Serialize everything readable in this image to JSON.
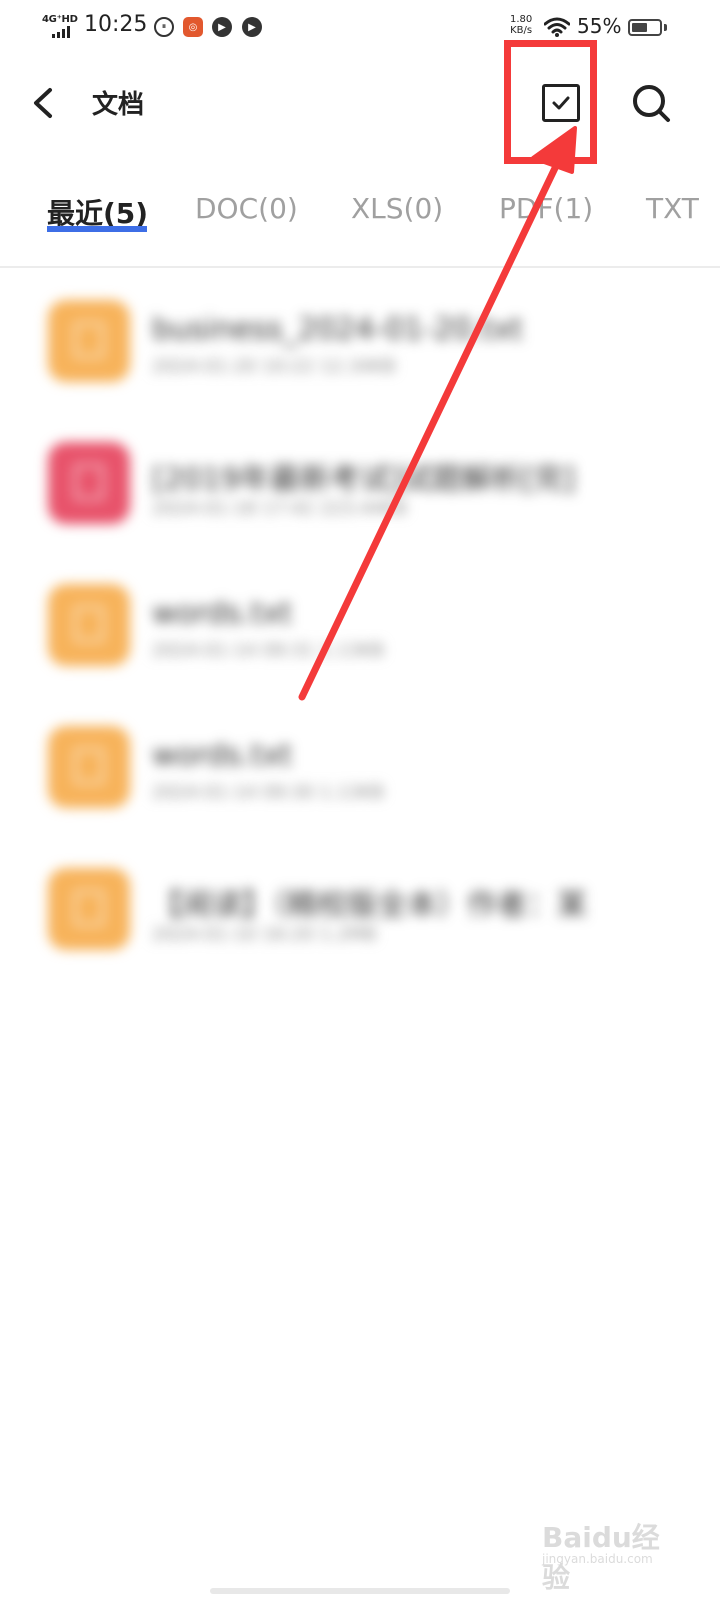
{
  "status_bar": {
    "network": "4G⁺HD",
    "time": "10:25",
    "net_speed_value": "1.80",
    "net_speed_unit": "KB/s",
    "battery_percent": "55%"
  },
  "header": {
    "title": "文档"
  },
  "tabs": [
    {
      "label": "最近(5)",
      "active": true
    },
    {
      "label": "DOC(0)",
      "active": false
    },
    {
      "label": "XLS(0)",
      "active": false
    },
    {
      "label": "PDF(1)",
      "active": false
    },
    {
      "label": "TXT",
      "active": false
    }
  ],
  "files": [
    {
      "name": "business_2024-01-20.txt",
      "meta": "2024-01-20 10:22 12.34KB",
      "type": "txt"
    },
    {
      "name": "[2019年最新考试]试题解析[完]",
      "meta": "2024-01-18 17:42 223.44KB",
      "type": "pdf"
    },
    {
      "name": "words.txt",
      "meta": "2024-01-14 09:31 1.13KB",
      "type": "txt"
    },
    {
      "name": "words.txt",
      "meta": "2024-01-14 09:30 1.13KB",
      "type": "txt"
    },
    {
      "name": "【阅读】（精校版全本）作者：某",
      "meta": "2024-01-10 16:20 1.2MB",
      "type": "txt"
    }
  ],
  "watermark": {
    "logo_text": "Baidu经验",
    "url": "jingyan.baidu.com"
  },
  "colors": {
    "accent": "#3d6ee6",
    "annotation": "#f43a3a",
    "txt_icon": "#f7b35b",
    "pdf_icon": "#e8536b"
  }
}
